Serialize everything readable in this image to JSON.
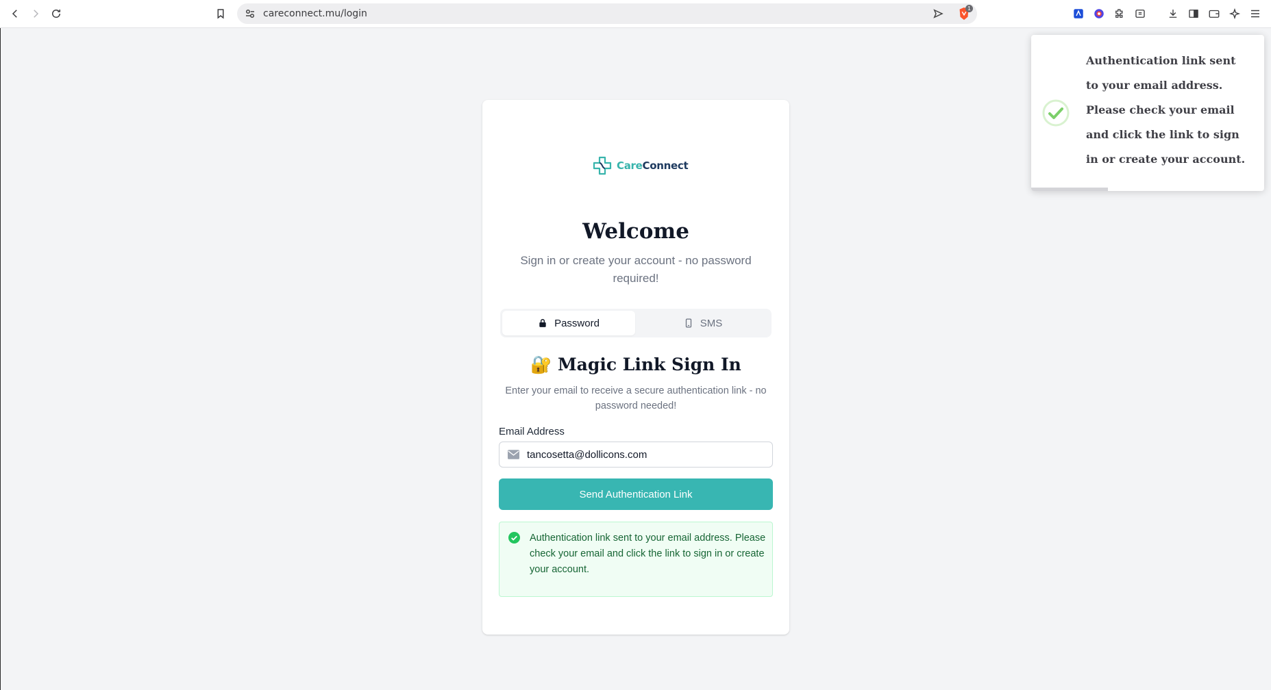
{
  "browser": {
    "url": "careconnect.mu/login",
    "shield_badge": "1",
    "icons": [
      "back-arrow-icon",
      "forward-arrow-icon",
      "reload-icon",
      "bookmark-icon",
      "site-settings-icon",
      "send-icon",
      "brave-shield-icon",
      "extension-icon",
      "color-icon",
      "puzzle-icon",
      "reader-icon",
      "download-icon",
      "sidebar-icon",
      "wallet-icon",
      "leo-icon",
      "menu-icon"
    ]
  },
  "brand": {
    "part1": "Care",
    "part2": "Connect",
    "accent": "#38b4ac",
    "dark": "#1e3a5f"
  },
  "login": {
    "title": "Welcome",
    "subtitle": "Sign in or create your account - no password required!",
    "tabs": [
      {
        "label": "Password",
        "icon": "lock-icon",
        "active": true
      },
      {
        "label": "SMS",
        "icon": "phone-icon",
        "active": false
      }
    ],
    "magic_title": "🔐 Magic Link Sign In",
    "magic_subtitle": "Enter your email to receive a secure authentication link - no password needed!",
    "email_label": "Email Address",
    "email_value": "tancosetta@dollicons.com",
    "submit_label": "Send Authentication Link",
    "submit_color": "#38b6b2",
    "success_message": "Authentication link sent to your email address. Please check your email and click the link to sign in or create your account."
  },
  "toast": {
    "message": "Authentication link sent to your email address. Please check your email and click the link to sign in or create your account.",
    "progress_remaining": 0.33
  }
}
